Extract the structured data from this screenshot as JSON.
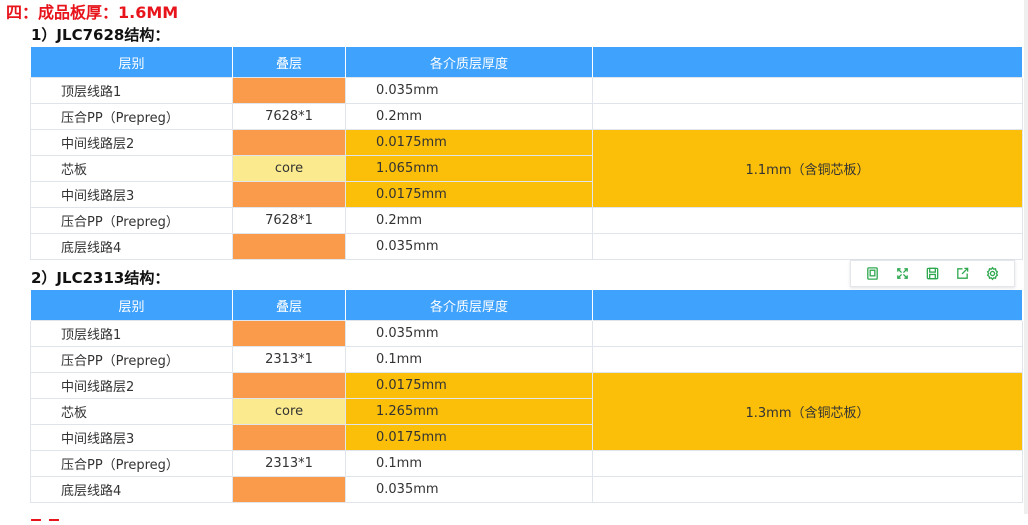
{
  "heading": "四：成品板厚：1.6MM",
  "sections": [
    {
      "title": "1）JLC7628结构：",
      "headers": [
        "层别",
        "叠层",
        "各介质层厚度",
        ""
      ],
      "rows": [
        {
          "name": "顶层线路1",
          "stack": "",
          "thickness": "0.035mm"
        },
        {
          "name": "压合PP（Prepreg）",
          "stack": "7628*1",
          "thickness": "0.2mm"
        },
        {
          "name": "中间线路层2",
          "stack": "",
          "thickness": "0.0175mm"
        },
        {
          "name": "芯板",
          "stack": "core",
          "thickness": "1.065mm"
        },
        {
          "name": "中间线路层3",
          "stack": "",
          "thickness": "0.0175mm"
        },
        {
          "name": "压合PP（Prepreg）",
          "stack": "7628*1",
          "thickness": "0.2mm"
        },
        {
          "name": "底层线路4",
          "stack": "",
          "thickness": "0.035mm"
        }
      ],
      "core_total": "1.1mm（含铜芯板）"
    },
    {
      "title": "2）JLC2313结构：",
      "headers": [
        "层别",
        "叠层",
        "各介质层厚度",
        ""
      ],
      "rows": [
        {
          "name": "顶层线路1",
          "stack": "",
          "thickness": "0.035mm"
        },
        {
          "name": "压合PP（Prepreg）",
          "stack": "2313*1",
          "thickness": "0.1mm"
        },
        {
          "name": "中间线路层2",
          "stack": "",
          "thickness": "0.0175mm"
        },
        {
          "name": "芯板",
          "stack": "core",
          "thickness": "1.265mm"
        },
        {
          "name": "中间线路层3",
          "stack": "",
          "thickness": "0.0175mm"
        },
        {
          "name": "压合PP（Prepreg）",
          "stack": "2313*1",
          "thickness": "0.1mm"
        },
        {
          "name": "底层线路4",
          "stack": "",
          "thickness": "0.035mm"
        }
      ],
      "core_total": "1.3mm（含铜芯板）"
    }
  ],
  "colors": {
    "header_bg": "#3fa2fc",
    "copper_layer": "#fa9a4b",
    "core_stack": "#fbeb8e",
    "core_region": "#fbbf0a",
    "heading_red": "#e8141b"
  },
  "toolbar": {
    "icons": [
      "clipboard-icon",
      "expand-icon",
      "save-icon",
      "share-icon",
      "settings-icon"
    ]
  }
}
